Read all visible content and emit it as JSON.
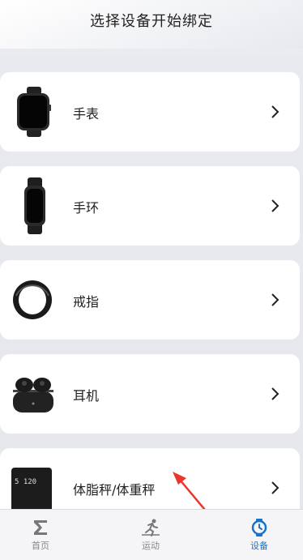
{
  "header": {
    "title": "选择设备开始绑定"
  },
  "devices": [
    {
      "label": "手表"
    },
    {
      "label": "手环"
    },
    {
      "label": "戒指"
    },
    {
      "label": "耳机"
    },
    {
      "label": "体脂秤/体重秤",
      "screen_text": "5 120"
    }
  ],
  "tabbar": {
    "items": [
      {
        "label": "首页",
        "icon": "sigma-icon"
      },
      {
        "label": "运动",
        "icon": "running-icon"
      },
      {
        "label": "设备",
        "icon": "watch-icon"
      }
    ],
    "active": "设备"
  },
  "colors": {
    "accent": "#1a73c9",
    "annotation_arrow": "#e8372c"
  }
}
